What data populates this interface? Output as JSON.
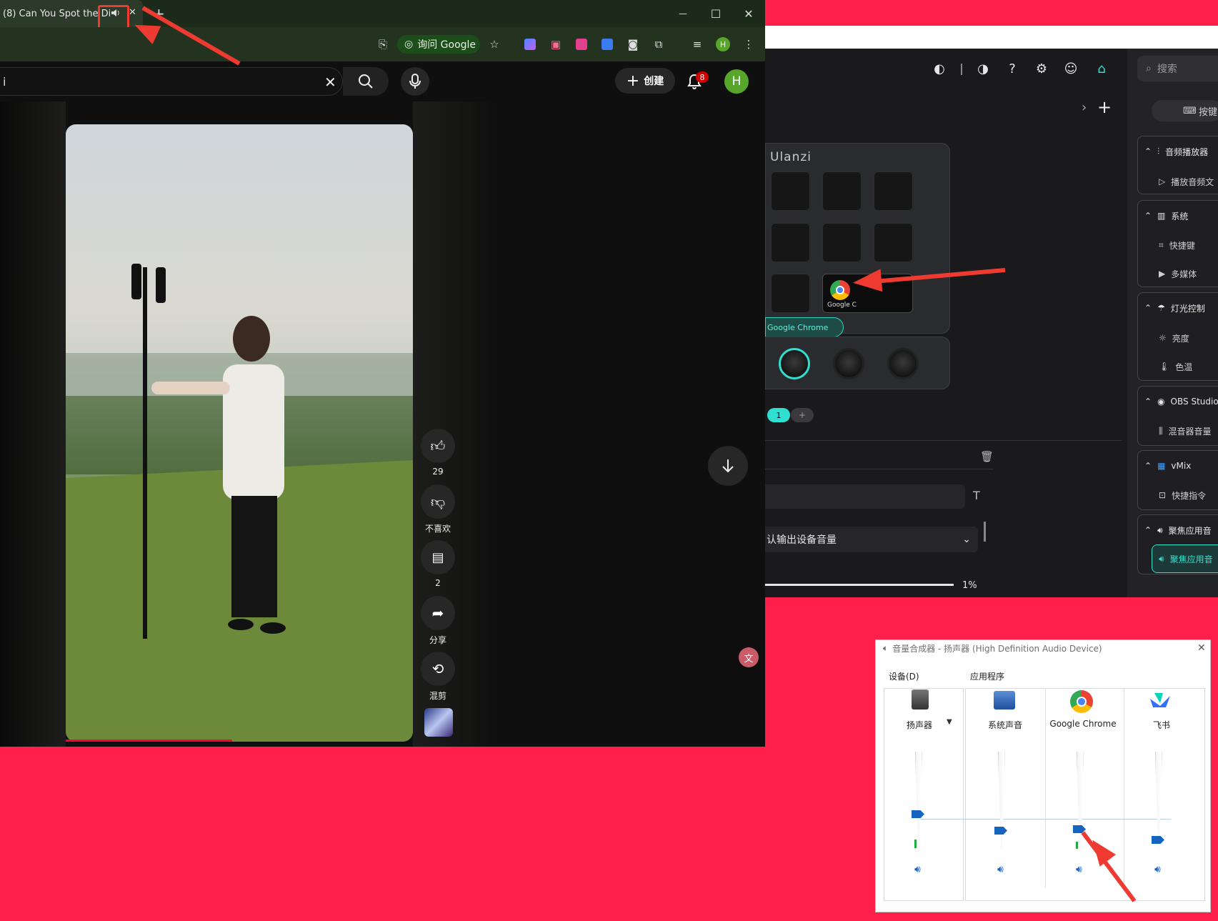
{
  "browser": {
    "tab_title": "(8) Can You Spot the Di",
    "tab_audio_icon": "speaker-icon",
    "new_tab": "+",
    "window_controls": {
      "minimize": "—",
      "maximize": "☐",
      "close": "✕"
    },
    "toolbar": {
      "ask_google": "询问 Google"
    },
    "youtube": {
      "search_value": "i",
      "create_label": "创建",
      "notification_count": "8",
      "avatar_initial": "H",
      "actions": [
        {
          "icon": "thumbs-up-icon",
          "label": "29"
        },
        {
          "icon": "thumbs-down-icon",
          "label": "不喜欢"
        },
        {
          "icon": "comment-icon",
          "label": "2"
        },
        {
          "icon": "share-icon",
          "label": "分享"
        },
        {
          "icon": "remix-icon",
          "label": "混剪"
        }
      ],
      "progress_fraction": 0.48
    }
  },
  "ulanzi": {
    "brand": "Ulanzi",
    "search_placeholder": "搜索",
    "key_button_label": "按键",
    "chrome_key_label": "Google C",
    "chrome_tip": "Google Chrome",
    "page_current": "1",
    "page_add": "+",
    "select_value": "认输出设备音量",
    "slider_value": "1%",
    "categories": [
      {
        "label": "音频播放器",
        "items": [
          "播放音频文"
        ]
      },
      {
        "label": "系统",
        "items": [
          "快捷键",
          "多媒体"
        ]
      },
      {
        "label": "灯光控制",
        "items": [
          "亮度",
          "色温"
        ]
      },
      {
        "label": "OBS Studio",
        "items": [
          "混音器音量"
        ]
      },
      {
        "label": "vMix",
        "items": [
          "快捷指令"
        ]
      },
      {
        "label": "聚焦应用音",
        "items": [
          "聚焦应用音"
        ]
      }
    ]
  },
  "mixer": {
    "title": "音量合成器 - 扬声器 (High Definition Audio Device)",
    "close": "✕",
    "device_group": "设备(D)",
    "apps_group": "应用程序",
    "columns": [
      {
        "name": "扬声器",
        "level": 0.62
      },
      {
        "name": "系统声音",
        "level": 0.45
      },
      {
        "name": "Google Chrome",
        "level": 0.46
      },
      {
        "name": "飞书",
        "level": 0.35
      }
    ]
  },
  "colors": {
    "accent_teal": "#2fe0d0",
    "youtube_red": "#ff0033",
    "background": "#ff1f4b",
    "arrow": "#ef3a32"
  }
}
